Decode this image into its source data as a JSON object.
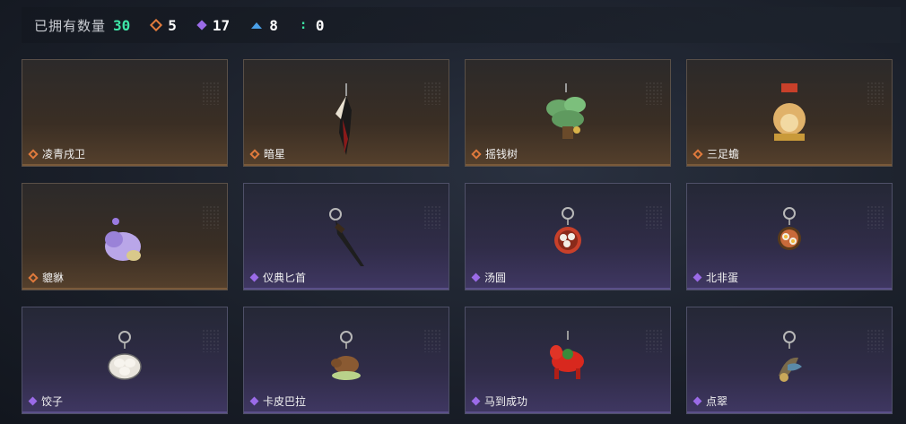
{
  "header": {
    "title": "已拥有数量",
    "total": "30",
    "stats": [
      {
        "icon": "orange-diamond-icon",
        "value": "5",
        "color": "#e07a3c"
      },
      {
        "icon": "purple-diamond-icon",
        "value": "17",
        "color": "#9b6be8"
      },
      {
        "icon": "blue-arrow-icon",
        "value": "8",
        "color": "#4aa0e8"
      },
      {
        "icon": "teal-dot-icon",
        "value": "0",
        "color": "#3ee6a6"
      }
    ]
  },
  "items": [
    {
      "name": "凌青戌卫",
      "rarity": "orange",
      "icon": "empty-slot"
    },
    {
      "name": "暗星",
      "rarity": "orange",
      "icon": "feather-blade-charm-icon"
    },
    {
      "name": "摇钱树",
      "rarity": "orange",
      "icon": "money-tree-charm-icon"
    },
    {
      "name": "三足蟾",
      "rarity": "orange",
      "icon": "three-legged-toad-charm-icon"
    },
    {
      "name": "貔貅",
      "rarity": "orange",
      "icon": "pixiu-charm-icon"
    },
    {
      "name": "仪典匕首",
      "rarity": "purple",
      "icon": "ceremonial-dagger-charm-icon"
    },
    {
      "name": "汤圆",
      "rarity": "purple",
      "icon": "tangyuan-charm-icon"
    },
    {
      "name": "北非蛋",
      "rarity": "purple",
      "icon": "shakshuka-charm-icon"
    },
    {
      "name": "饺子",
      "rarity": "purple",
      "icon": "dumpling-charm-icon"
    },
    {
      "name": "卡皮巴拉",
      "rarity": "purple",
      "icon": "capybara-charm-icon"
    },
    {
      "name": "马到成功",
      "rarity": "purple",
      "icon": "red-horse-charm-icon"
    },
    {
      "name": "点翠",
      "rarity": "purple",
      "icon": "kingfisher-charm-icon"
    }
  ]
}
